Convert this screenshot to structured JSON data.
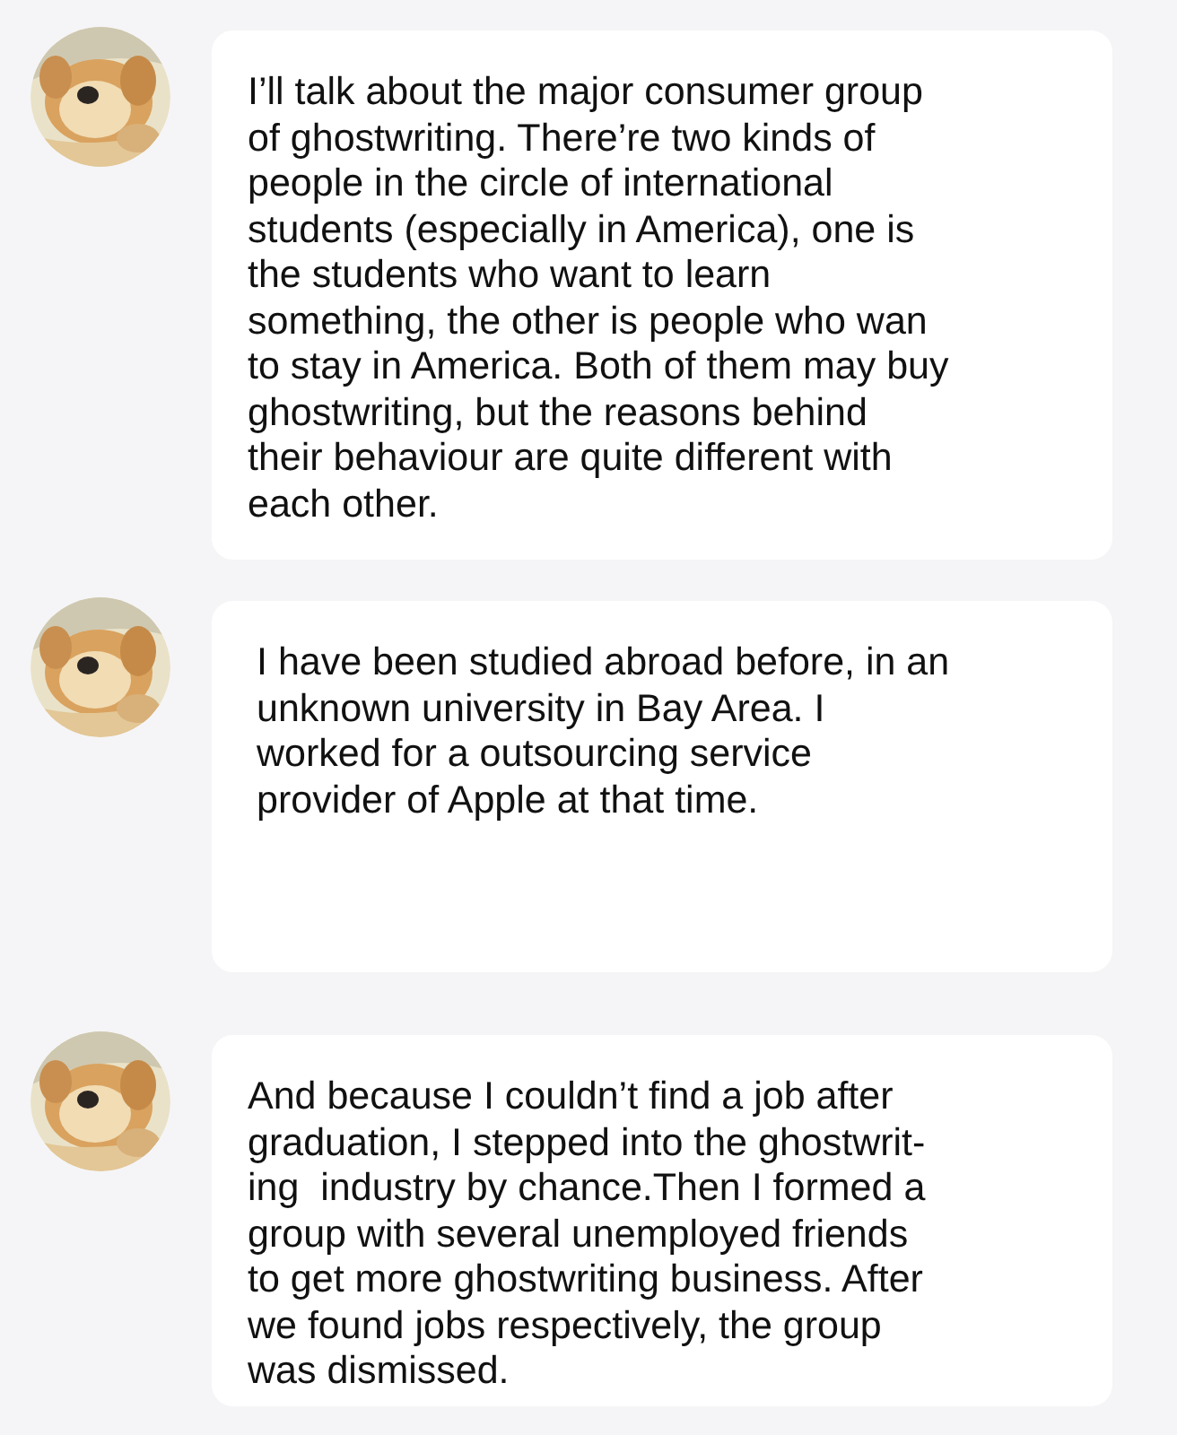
{
  "messages": [
    {
      "lines": [
        "I’ll talk about the major consumer group",
        "of ghostwriting. There’re two kinds of",
        "people in the circle of international",
        "students (especially in America), one is",
        "the students who want to learn",
        "something, the other is people who wan",
        "to stay in America. Both of them may buy",
        "ghostwriting, but the reasons behind",
        "their behaviour are quite different with",
        "each other."
      ]
    },
    {
      "lines": [
        "I have been studied abroad before, in an",
        "unknown university in Bay Area. I",
        "worked for a outsourcing service",
        "provider of Apple at that time."
      ]
    },
    {
      "lines": [
        "And because I couldn’t find a job after",
        "graduation, I stepped into the ghostwrit-",
        "ing  industry by chance.Then I formed a",
        "group with several unemployed friends",
        "to get more ghostwriting business. After",
        "we found jobs respectively, the group",
        "was dismissed."
      ]
    }
  ]
}
